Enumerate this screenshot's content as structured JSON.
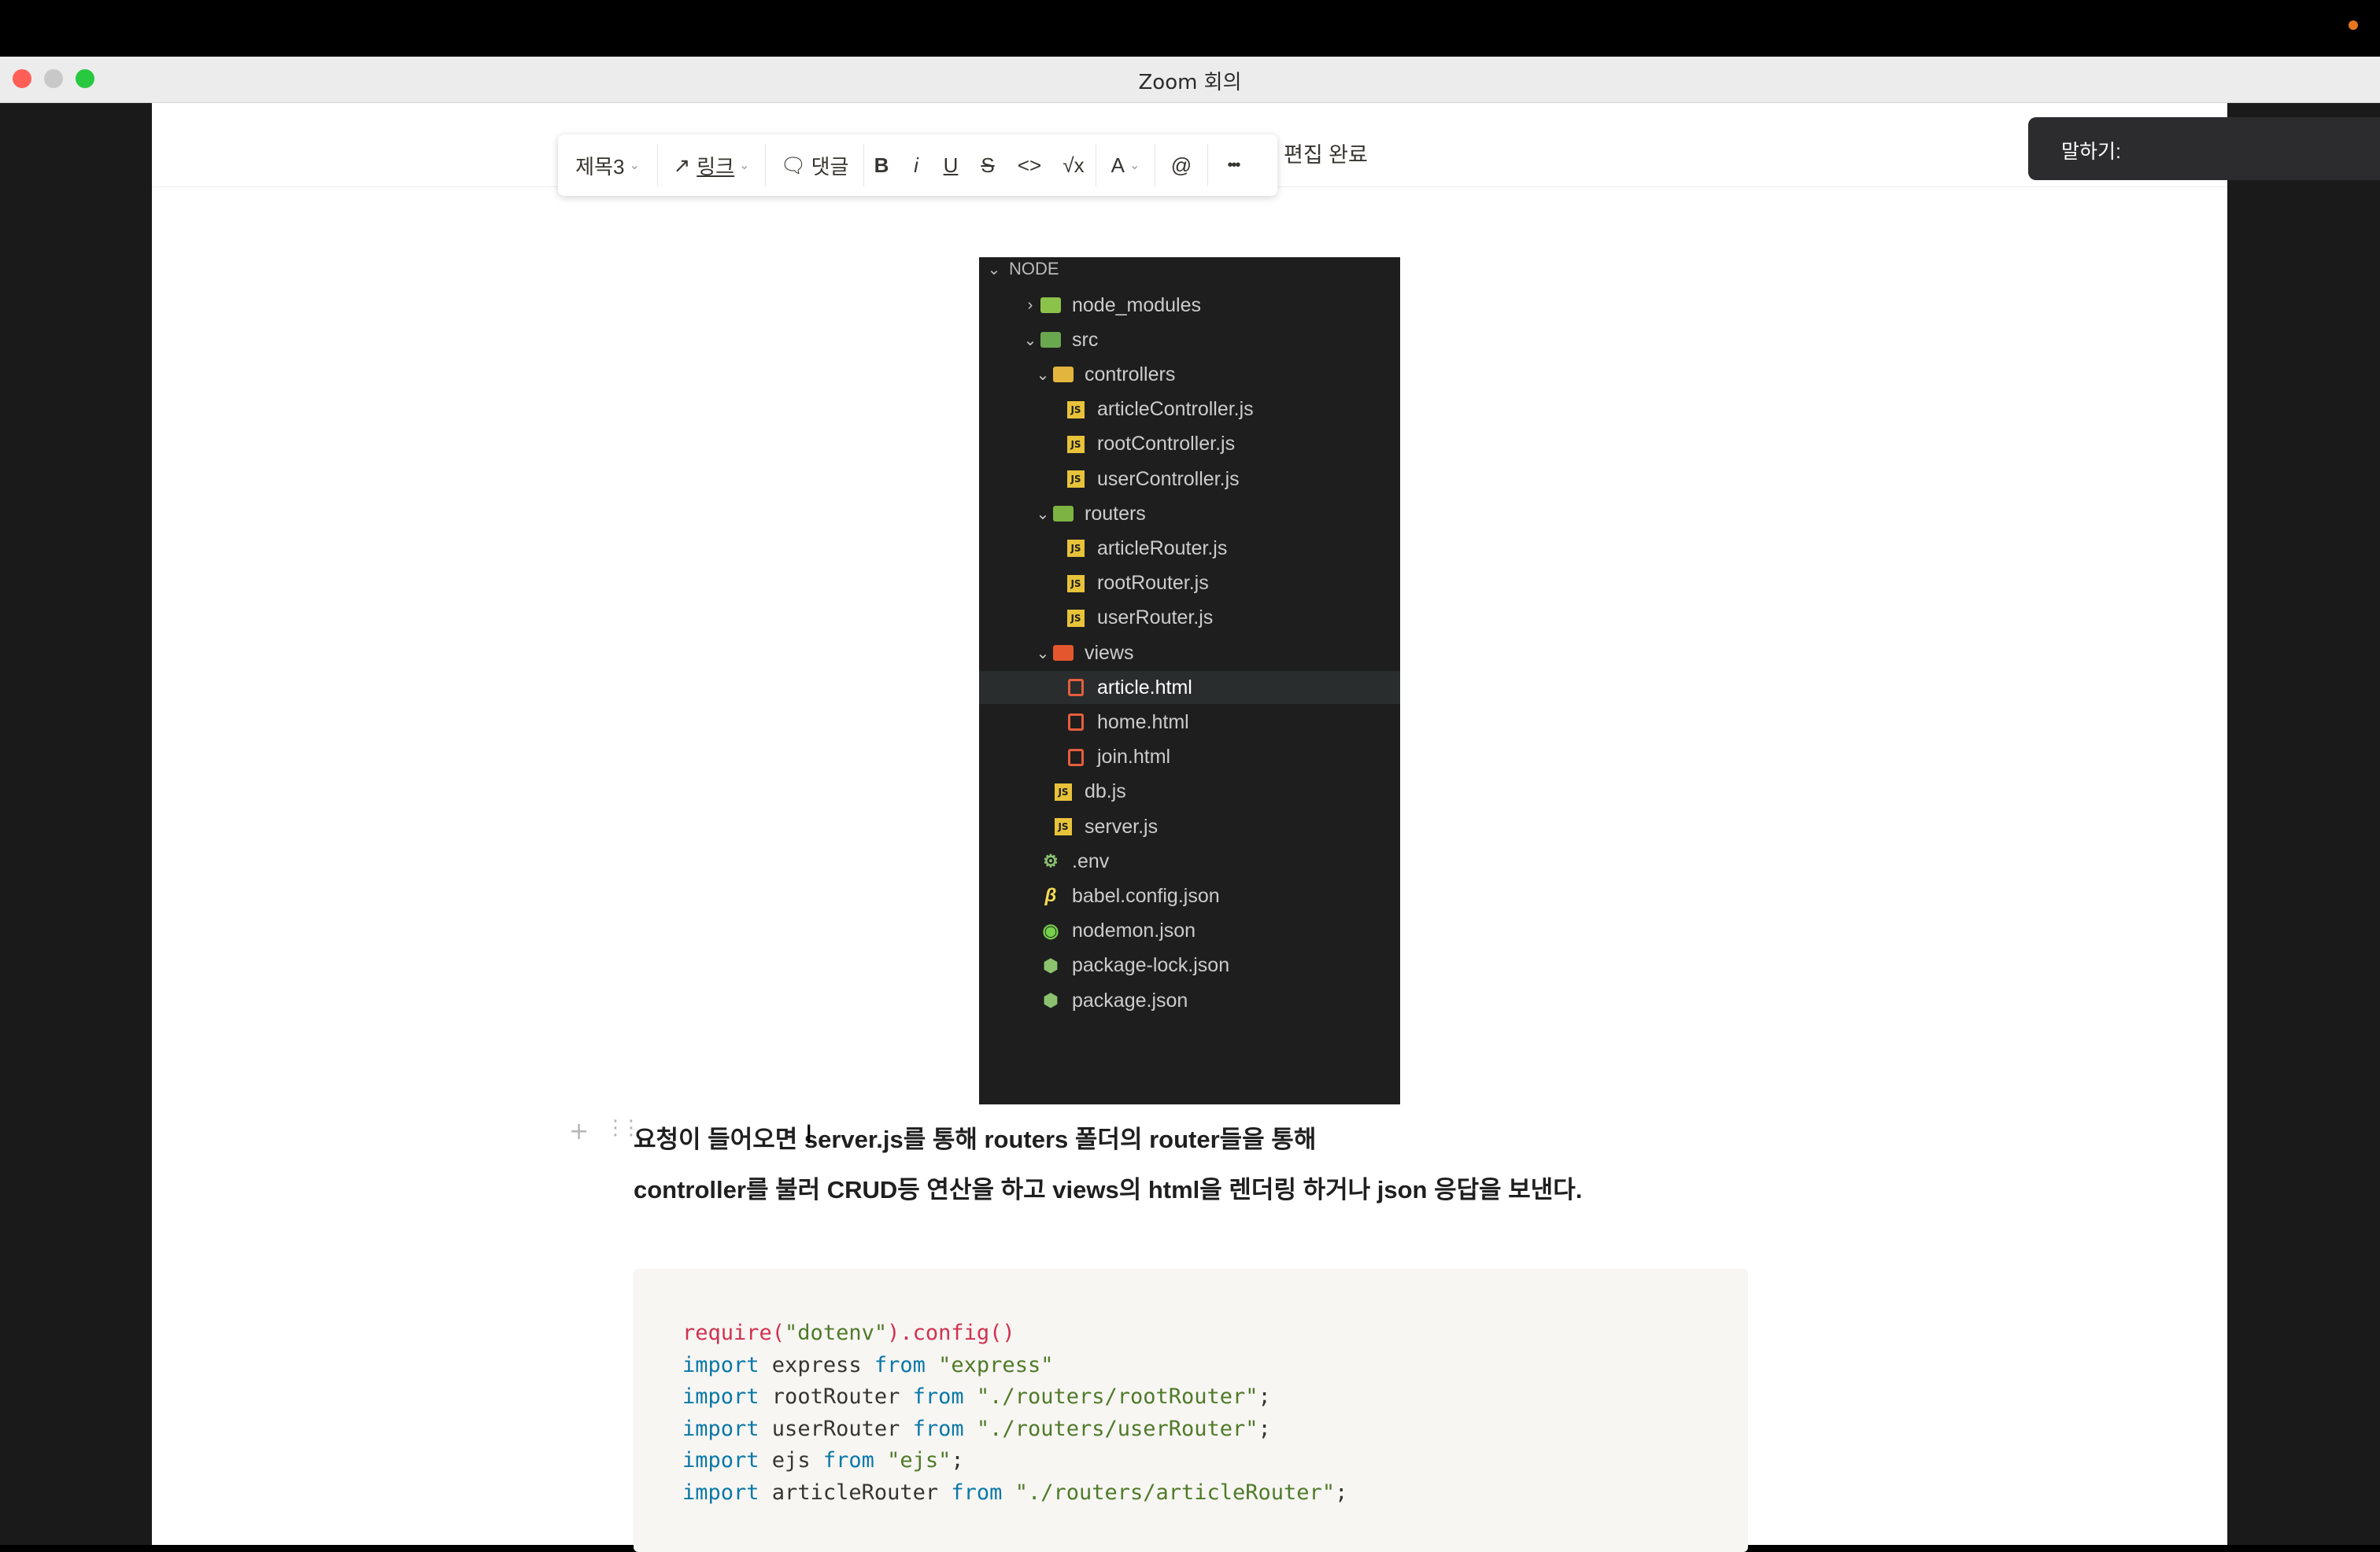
{
  "window": {
    "title": "Zoom 회의"
  },
  "toolbar": {
    "heading_label": "제목3",
    "link_label": "링크",
    "comment_label": "댓글",
    "bold_label": "B",
    "italic_label": "i",
    "underline_label": "U",
    "strike_label": "S",
    "code_label": "<>",
    "math_label": "√x",
    "color_label": "A",
    "mention_label": "@",
    "more_label": "•••",
    "edit_done_label": "편집 완료"
  },
  "speaking": {
    "label": "말하기:"
  },
  "file_tree": {
    "root": "NODE",
    "items": [
      {
        "label": "node_modules",
        "type": "folder",
        "depth": 0,
        "expanded": false
      },
      {
        "label": "src",
        "type": "folder",
        "depth": 0,
        "expanded": true
      },
      {
        "label": "controllers",
        "type": "folder",
        "depth": 1,
        "expanded": true
      },
      {
        "label": "articleController.js",
        "type": "js",
        "depth": 2
      },
      {
        "label": "rootController.js",
        "type": "js",
        "depth": 2
      },
      {
        "label": "userController.js",
        "type": "js",
        "depth": 2
      },
      {
        "label": "routers",
        "type": "folder",
        "depth": 1,
        "expanded": true
      },
      {
        "label": "articleRouter.js",
        "type": "js",
        "depth": 2
      },
      {
        "label": "rootRouter.js",
        "type": "js",
        "depth": 2
      },
      {
        "label": "userRouter.js",
        "type": "js",
        "depth": 2
      },
      {
        "label": "views",
        "type": "folder",
        "depth": 1,
        "expanded": true
      },
      {
        "label": "article.html",
        "type": "html",
        "depth": 2,
        "selected": true
      },
      {
        "label": "home.html",
        "type": "html",
        "depth": 2
      },
      {
        "label": "join.html",
        "type": "html",
        "depth": 2
      },
      {
        "label": "db.js",
        "type": "js",
        "depth": 1
      },
      {
        "label": "server.js",
        "type": "js",
        "depth": 1
      },
      {
        "label": ".env",
        "type": "env",
        "depth": 0
      },
      {
        "label": "babel.config.json",
        "type": "babel",
        "depth": 0
      },
      {
        "label": "nodemon.json",
        "type": "nodemon",
        "depth": 0
      },
      {
        "label": "package-lock.json",
        "type": "pkg",
        "depth": 0
      },
      {
        "label": "package.json",
        "type": "pkg",
        "depth": 0
      }
    ]
  },
  "body_text": {
    "line1": "요청이 들어오면 server.js를 통해 routers 폴더의 router들을 통해",
    "line2": "controller를 불러 CRUD등 연산을 하고 views의 html을 렌더링 하거나 json 응답을 보낸다."
  },
  "code_lines": [
    "require(\"dotenv\").config()",
    "import express from \"express\"",
    "import rootRouter from \"./routers/rootRouter\";",
    "import userRouter from \"./routers/userRouter\";",
    "import ejs from \"ejs\";",
    "import articleRouter from \"./routers/articleRouter\";"
  ]
}
